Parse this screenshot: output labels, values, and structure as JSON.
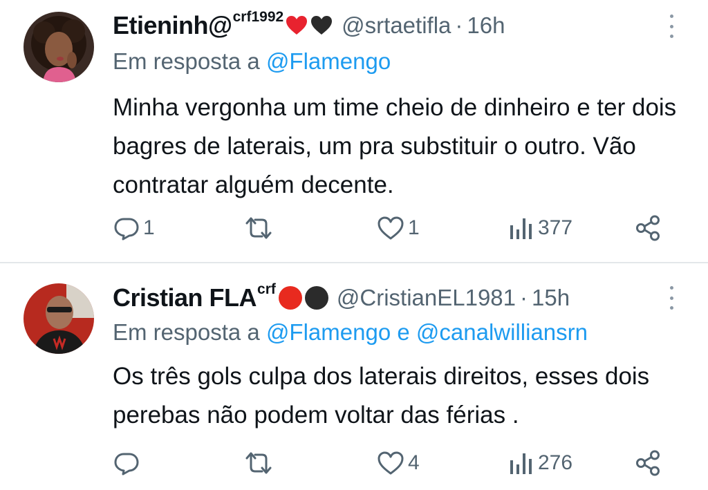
{
  "colors": {
    "text": "#0f1419",
    "secondary": "#536471",
    "link": "#1d9bf0",
    "divider": "#e3e7ea"
  },
  "tweets": [
    {
      "display_name": "Etieninh@",
      "name_superscript": "crf1992",
      "name_emojis": [
        "red-heart",
        "black-heart"
      ],
      "handle": "@srtaetifla",
      "separator": "·",
      "time": "16h",
      "reply_prefix": "Em resposta a",
      "reply_mentions": [
        "@Flamengo"
      ],
      "reply_joiner": "",
      "text": "Minha vergonha um time cheio de dinheiro e ter dois bagres de laterais, um pra substituir o outro. Vão contratar alguém decente.",
      "stats": {
        "replies": "1",
        "retweets": "",
        "likes": "1",
        "views": "377"
      }
    },
    {
      "display_name": "Cristian FLA",
      "name_superscript": "crf",
      "name_emojis": [
        "red-circle",
        "black-circle"
      ],
      "handle": "@CristianEL1981",
      "separator": "·",
      "time": "15h",
      "reply_prefix": "Em resposta a",
      "reply_mentions": [
        "@Flamengo",
        "@canalwilliansrn"
      ],
      "reply_joiner": "e",
      "text": "Os três gols culpa dos laterais direitos, esses dois perebas não podem voltar das férias .",
      "stats": {
        "replies": "",
        "retweets": "",
        "likes": "4",
        "views": "276"
      }
    }
  ]
}
